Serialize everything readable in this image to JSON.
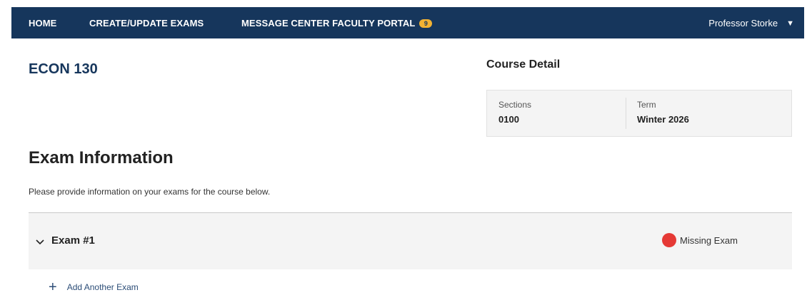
{
  "nav": {
    "home": "HOME",
    "create_update_exams": "CREATE/UPDATE EXAMS",
    "message_center": "MESSAGE CENTER FACULTY PORTAL",
    "message_count": "9",
    "user": "Professor Storke",
    "user_caret_icon": "caret-down-icon"
  },
  "course": {
    "title": "ECON 130"
  },
  "course_detail": {
    "title": "Course Detail",
    "sections_label": "Sections",
    "sections_value": "0100",
    "term_label": "Term",
    "term_value": "Winter 2026"
  },
  "exam_info": {
    "heading": "Exam Information",
    "description": "Please provide information on your exams for the course below.",
    "exams": [
      {
        "name": "Exam #1",
        "status": "Missing Exam",
        "status_color": "#e53935"
      }
    ],
    "add_label": "Add Another Exam"
  },
  "colors": {
    "nav_bg": "#16365c",
    "badge": "#f2b233",
    "accent_text": "#16365c"
  }
}
